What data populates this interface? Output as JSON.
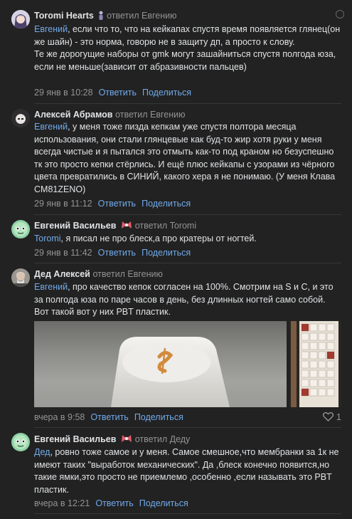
{
  "comments": [
    {
      "author": "Toromi Hearts",
      "replied": "ответил Евгению",
      "mention": "Евгений",
      "text": ", если что то, что на кейкапах спустя время появляется глянец(он же шайн) - это норма, говорю не в защиту дп, а просто к слову.",
      "text2": "Те же дорогущие наборы от gmk могут зашайниться спустя полгода юза, если не меньше(зависит от абразивности пальцев)",
      "date": "29 янв в 10:28",
      "reply": "Ответить",
      "share": "Поделиться"
    },
    {
      "author": "Алексей Абрамов",
      "replied": "ответил Евгению",
      "mention": "Евгений",
      "text": ", у меня тоже пизда кепкам уже спустя полтора месяца использования, они стали глянцевые как буд-то жир хотя руки у меня всегда чистые и я пытался это отмыть как-то под краном но безуспешно тк это просто кепки стёрлись. И ещё плюс кейкапы с узорами из чёрного цвета превратились в СИНИЙ, какого хера я не понимаю. (У меня Клава CM81ZENO)",
      "date": "29 янв в 11:12",
      "reply": "Ответить",
      "share": "Поделиться"
    },
    {
      "author": "Евгений Васильев",
      "replied": "ответил Toromi",
      "mention": "Toromi",
      "text": ", я писал не про блеск,а про кратеры от ногтей.",
      "date": "29 янв в 11:42",
      "reply": "Ответить",
      "share": "Поделиться"
    },
    {
      "author": "Дед Алексей",
      "replied": "ответил Евгению",
      "mention": "Евгений",
      "text": ", про качество кепок согласен на 100%. Смотрим на S и C, и это за полгода юза по паре часов в день, без длинных ногтей само собой. Вот такой вот у них PBT пластик.",
      "date": "вчера в 9:58",
      "reply": "Ответить",
      "share": "Поделиться",
      "likes": "1"
    },
    {
      "author": "Евгений Васильев",
      "replied": "ответил Деду",
      "mention": "Дед",
      "text": ", ровно тоже самое и у меня. Самое смешное,что мембранки за 1к не имеют таких \"выработок механических\". Да ,блеск конечно появится,но такие ямки,это просто не приемлемо ,особенно ,если называть это PBT пластик.",
      "date": "вчера в 12:21",
      "reply": "Ответить",
      "share": "Поделиться"
    }
  ]
}
